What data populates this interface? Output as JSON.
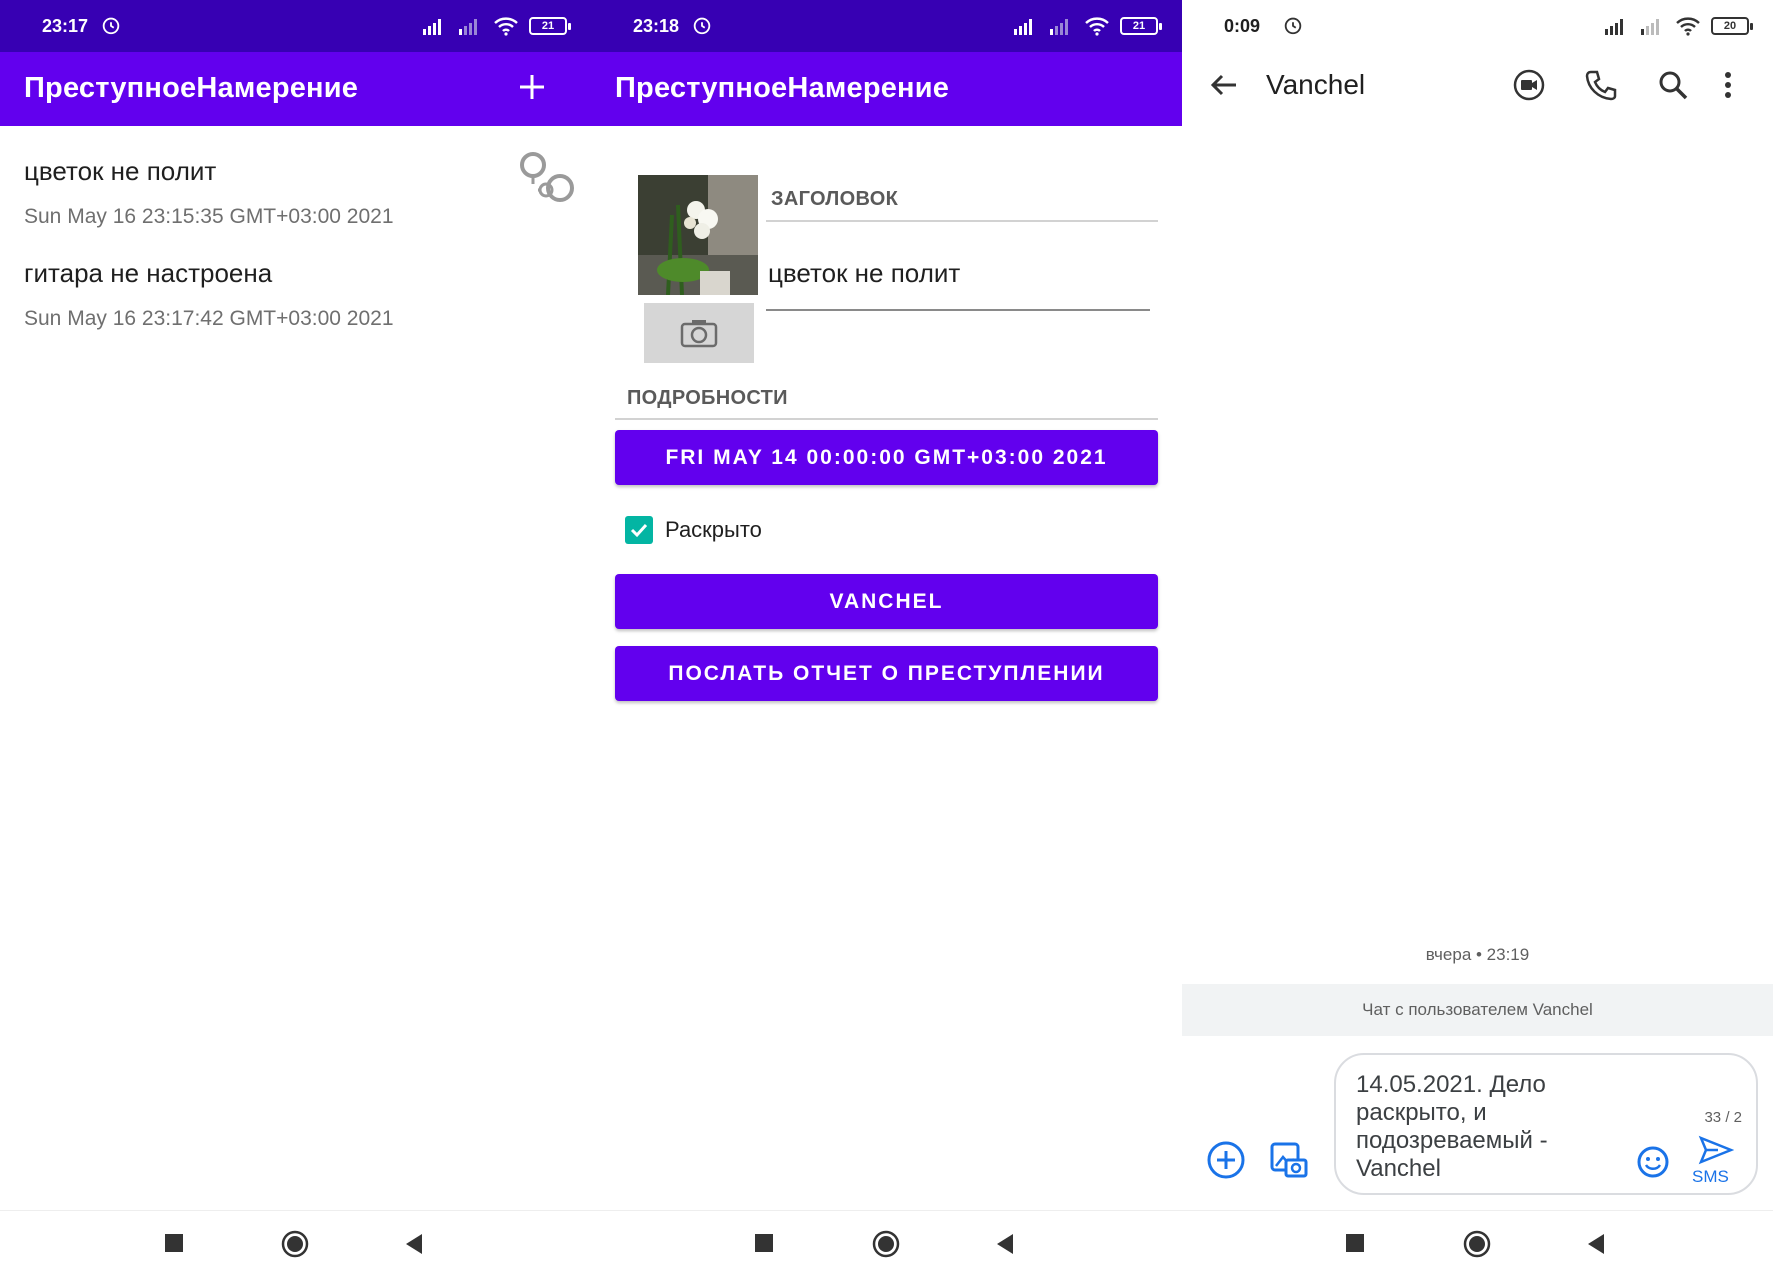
{
  "colors": {
    "status_purple": "#3700b3",
    "app_purple": "#6200ee",
    "teal": "#03b5a3",
    "sms_blue": "#1a73e8"
  },
  "screen1": {
    "status": {
      "time": "23:17",
      "battery": "21"
    },
    "app_title": "ПреступноеНамерение",
    "add_icon": "plus-icon",
    "crimes": [
      {
        "title": "цветок не полит",
        "date": "Sun May 16 23:15:35 GMT+03:00 2021",
        "solved": true
      },
      {
        "title": "гитара не настроена",
        "date": "Sun May 16 23:17:42 GMT+03:00 2021",
        "solved": false
      }
    ],
    "solved_icon": "handcuffs-icon"
  },
  "screen2": {
    "status": {
      "time": "23:18",
      "battery": "21"
    },
    "app_title": "ПреступноеНамерение",
    "title_label": "ЗАГОЛОВОК",
    "title_value": "цветок не полит",
    "details_label": "ПОДРОБНОСТИ",
    "date_button": "FRI MAY 14 00:00:00 GMT+03:00 2021",
    "solved_label": "Раскрыто",
    "solved_checked": true,
    "suspect_button": "VANCHEL",
    "report_button": "ПОСЛАТЬ ОТЧЕТ О ПРЕСТУПЛЕНИИ"
  },
  "screen3": {
    "status": {
      "time": "0:09",
      "battery": "20"
    },
    "contact": "Vanchel",
    "timestamp": "вчера • 23:19",
    "chat_info": "Чат с пользователем Vanchel",
    "message_draft": "14.05.2021. Дело\nраскрыто, и\nподозреваемый -\nVanchel",
    "char_count": "33 / 2",
    "send_label": "SMS"
  }
}
